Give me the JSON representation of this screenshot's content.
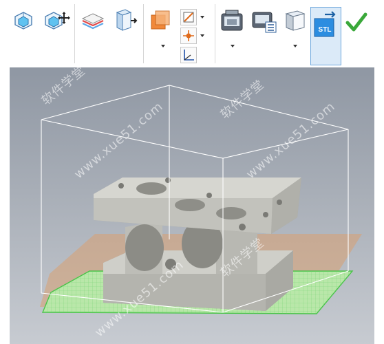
{
  "toolbar": {
    "stl_label": "STL",
    "icons": [
      "view-cube-icon",
      "view-orbit-icon",
      "layers-icon",
      "export-box-icon",
      "orange-square-icon",
      "plane-line-icon",
      "point-icon",
      "axis-icon",
      "print-preview-icon",
      "print-settings-icon",
      "box-icon",
      "stl-export-icon",
      "checkmark-icon"
    ]
  },
  "watermarks": [
    "软件学堂",
    "www.xue51.com",
    "软件学堂",
    "www.xue51.com",
    "软件学堂",
    "www.xue51.com"
  ],
  "colors": {
    "accent": "#2c8de0",
    "grid": "#7fe07f",
    "part": "#c8c8c2",
    "check": "#3aa83a"
  }
}
